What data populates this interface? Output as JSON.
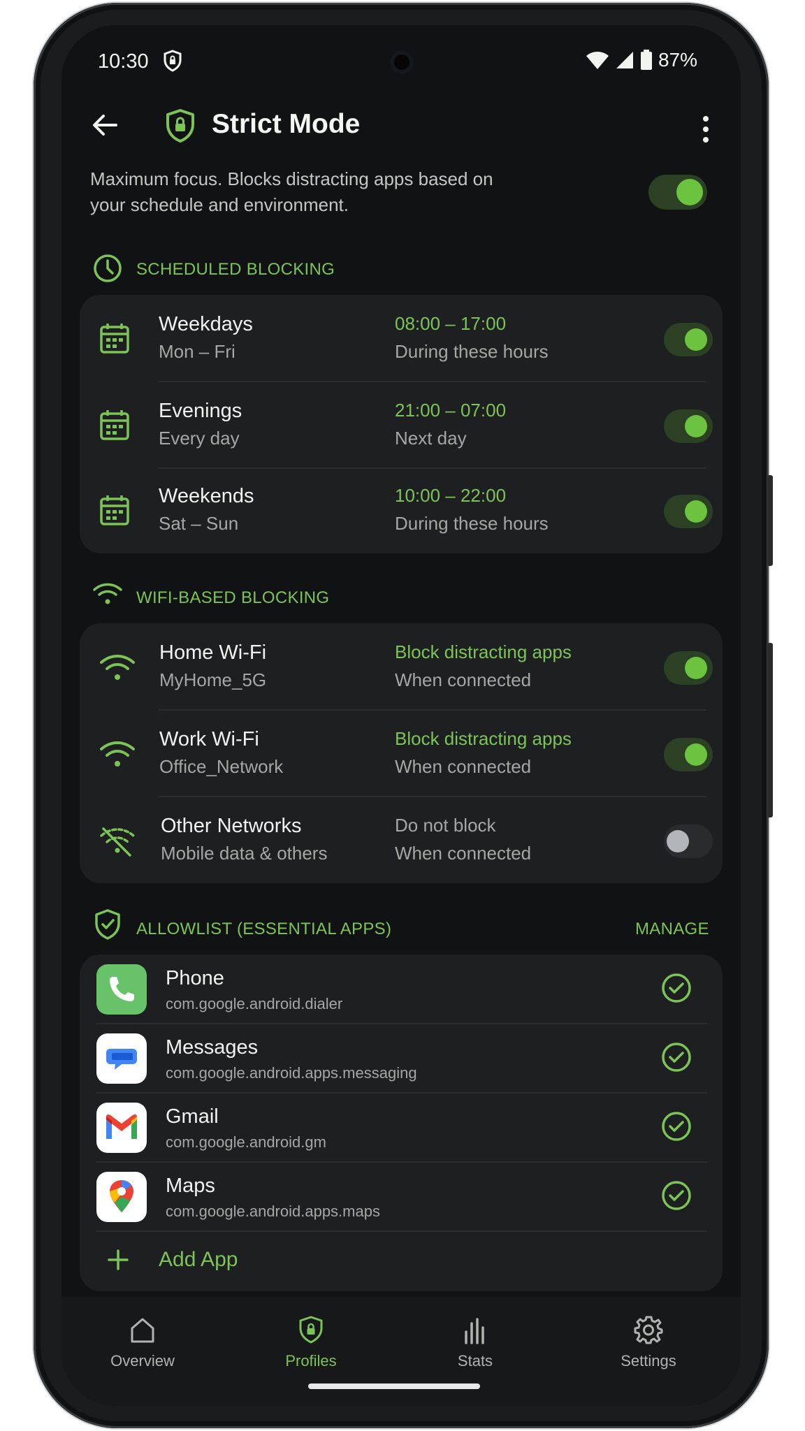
{
  "status_bar": {
    "time": "10:30",
    "battery": "87%"
  },
  "header": {
    "title": "Strict Mode"
  },
  "description": "Maximum focus. Blocks distracting apps based on your schedule and environment.",
  "master_toggle_on": true,
  "accent_color": "#7cc455",
  "scheduled": {
    "heading": "SCHEDULED BLOCKING",
    "items": [
      {
        "title": "Weekdays",
        "sub": "Mon – Fri",
        "time": "08:00 – 17:00",
        "note": "During these hours",
        "on": true
      },
      {
        "title": "Evenings",
        "sub": "Every day",
        "time": "21:00 – 07:00",
        "note": "Next day",
        "on": true
      },
      {
        "title": "Weekends",
        "sub": "Sat – Sun",
        "time": "10:00 – 22:00",
        "note": "During these hours",
        "on": true
      }
    ]
  },
  "wifi": {
    "heading": "WIFI-BASED BLOCKING",
    "items": [
      {
        "title": "Home Wi-Fi",
        "sub": "MyHome_5G",
        "action": "Block distracting apps",
        "note": "When connected",
        "on": true,
        "icon": "wifi-icon"
      },
      {
        "title": "Work Wi-Fi",
        "sub": "Office_Network",
        "action": "Block distracting apps",
        "note": "When connected",
        "on": true,
        "icon": "wifi-icon"
      },
      {
        "title": "Other Networks",
        "sub": "Mobile data & others",
        "action": "Do not block",
        "note": "When connected",
        "on": false,
        "icon": "wifi-off-icon"
      }
    ]
  },
  "allowlist": {
    "heading": "ALLOWLIST (ESSENTIAL APPS)",
    "manage": "MANAGE",
    "apps": [
      {
        "name": "Phone",
        "pkg": "com.google.android.dialer",
        "icon": "phone-app-icon"
      },
      {
        "name": "Messages",
        "pkg": "com.google.android.apps.messaging",
        "icon": "messages-app-icon"
      },
      {
        "name": "Gmail",
        "pkg": "com.google.android.gm",
        "icon": "gmail-app-icon"
      },
      {
        "name": "Maps",
        "pkg": "com.google.android.apps.maps",
        "icon": "maps-app-icon"
      }
    ],
    "add_label": "Add App"
  },
  "nav": [
    {
      "label": "Overview",
      "icon": "home-icon",
      "active": false
    },
    {
      "label": "Profiles",
      "icon": "shield-lock-icon",
      "active": true
    },
    {
      "label": "Stats",
      "icon": "bar-chart-icon",
      "active": false
    },
    {
      "label": "Settings",
      "icon": "gear-icon",
      "active": false
    }
  ]
}
